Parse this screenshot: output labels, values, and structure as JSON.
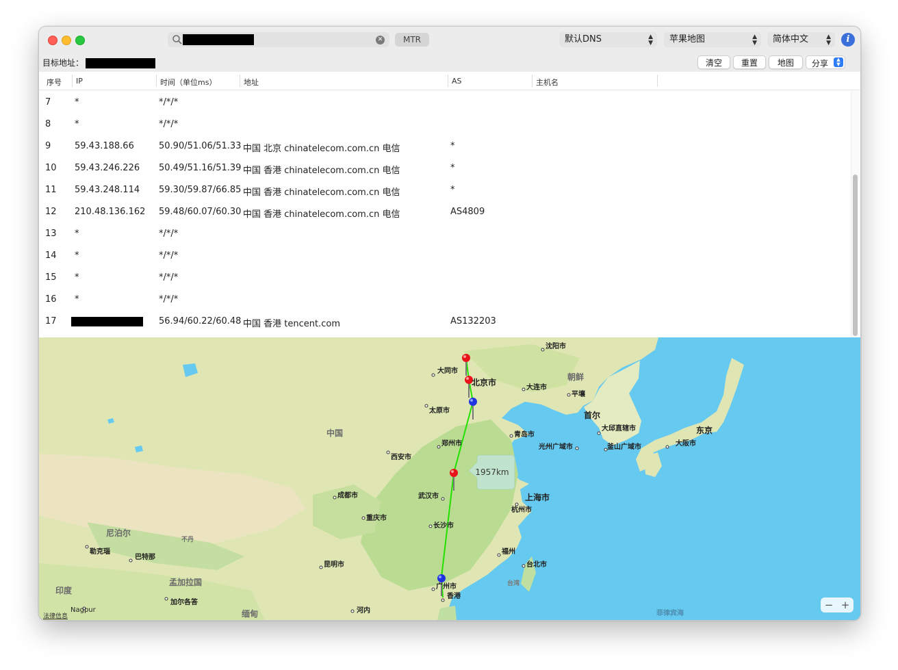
{
  "window": {
    "search_placeholder": "",
    "mtr_label": "MTR",
    "dns_select": "默认DNS",
    "map_select": "苹果地图",
    "lang_select": "简体中文"
  },
  "target": {
    "label": "目标地址："
  },
  "buttons": {
    "clear": "清空",
    "reset": "重置",
    "map": "地图",
    "share": "分享"
  },
  "table": {
    "headers": [
      "序号",
      "IP",
      "时间（单位ms）",
      "地址",
      "AS",
      "主机名"
    ],
    "rows": [
      {
        "n": "7",
        "ip": "*",
        "time": "*/*/*",
        "addr": "",
        "as": ""
      },
      {
        "n": "8",
        "ip": "*",
        "time": "*/*/*",
        "addr": "",
        "as": ""
      },
      {
        "n": "9",
        "ip": "59.43.188.66",
        "time": "50.90/51.06/51.33",
        "addr": "中国 北京 chinatelecom.com.cn 电信",
        "as": "*"
      },
      {
        "n": "10",
        "ip": "59.43.246.226",
        "time": "50.49/51.16/51.39",
        "addr": "中国 香港 chinatelecom.com.cn 电信",
        "as": "*"
      },
      {
        "n": "11",
        "ip": "59.43.248.114",
        "time": "59.30/59.87/66.85",
        "addr": "中国 香港 chinatelecom.com.cn 电信",
        "as": "*"
      },
      {
        "n": "12",
        "ip": "210.48.136.162",
        "time": "59.48/60.07/60.30",
        "addr": "中国 香港 chinatelecom.com.cn 电信",
        "as": "AS4809"
      },
      {
        "n": "13",
        "ip": "*",
        "time": "*/*/*",
        "addr": "",
        "as": ""
      },
      {
        "n": "14",
        "ip": "*",
        "time": "*/*/*",
        "addr": "",
        "as": ""
      },
      {
        "n": "15",
        "ip": "*",
        "time": "*/*/*",
        "addr": "",
        "as": ""
      },
      {
        "n": "16",
        "ip": "*",
        "time": "*/*/*",
        "addr": "",
        "as": ""
      },
      {
        "n": "17",
        "ip": "",
        "time": "56.94/60.22/60.48",
        "addr": "中国 香港 tencent.com",
        "as": "AS132203"
      }
    ]
  },
  "map": {
    "distance_label": "1957km",
    "legal_label": "法律信息",
    "zoom_out": "−",
    "zoom_in": "+",
    "region_labels": [
      "中国",
      "朝鲜",
      "首尔",
      "东京",
      "尼泊尔",
      "不丹",
      "孟加拉国",
      "印度",
      "缅甸",
      "台湾",
      "菲律宾海"
    ],
    "city_labels": [
      "沈阳市",
      "大同市",
      "北京市",
      "大连市",
      "平壤",
      "太原市",
      "青岛市",
      "大邱直辖市",
      "郑州市",
      "光州广域市",
      "釜山广域市",
      "大阪市",
      "西安市",
      "成都市",
      "武汉市",
      "上海市",
      "杭州市",
      "重庆市",
      "长沙市",
      "福州",
      "台北市",
      "昆明市",
      "广州市",
      "香港",
      "河内",
      "勒克瑙",
      "巴特那",
      "加尔各答",
      "Nagpur"
    ],
    "colors": {
      "sea": "#66c9ef",
      "land": "#dfe7b4",
      "route": "#22e000",
      "pin_red": "#e8141a",
      "pin_blue": "#1f34e0"
    }
  }
}
